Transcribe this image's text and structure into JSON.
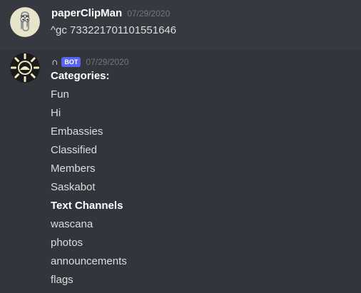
{
  "messages": [
    {
      "username": "paperClipMan",
      "timestamp": "07/29/2020",
      "text": "^gc 733221701101551646",
      "avatar_icon": "paperclip-avatar-icon"
    },
    {
      "username": "∩",
      "bot_tag": "BOT",
      "timestamp": "07/29/2020",
      "avatar_icon": "sun-avatar-icon",
      "lines": [
        {
          "text": "Categories:",
          "bold": true
        },
        {
          "text": "Fun",
          "bold": false
        },
        {
          "text": "Hi",
          "bold": false
        },
        {
          "text": "Embassies",
          "bold": false
        },
        {
          "text": "Classified",
          "bold": false
        },
        {
          "text": "Members",
          "bold": false
        },
        {
          "text": "Saskabot",
          "bold": false
        },
        {
          "text": "Text Channels",
          "bold": true
        },
        {
          "text": "wascana",
          "bold": false
        },
        {
          "text": "photos",
          "bold": false
        },
        {
          "text": "announcements",
          "bold": false
        },
        {
          "text": "flags",
          "bold": false
        }
      ]
    }
  ],
  "colors": {
    "background": "#36393f",
    "hover_background": "#32353b",
    "bot_tag": "#5865f2",
    "timestamp": "#72767d",
    "text": "#dcddde"
  }
}
